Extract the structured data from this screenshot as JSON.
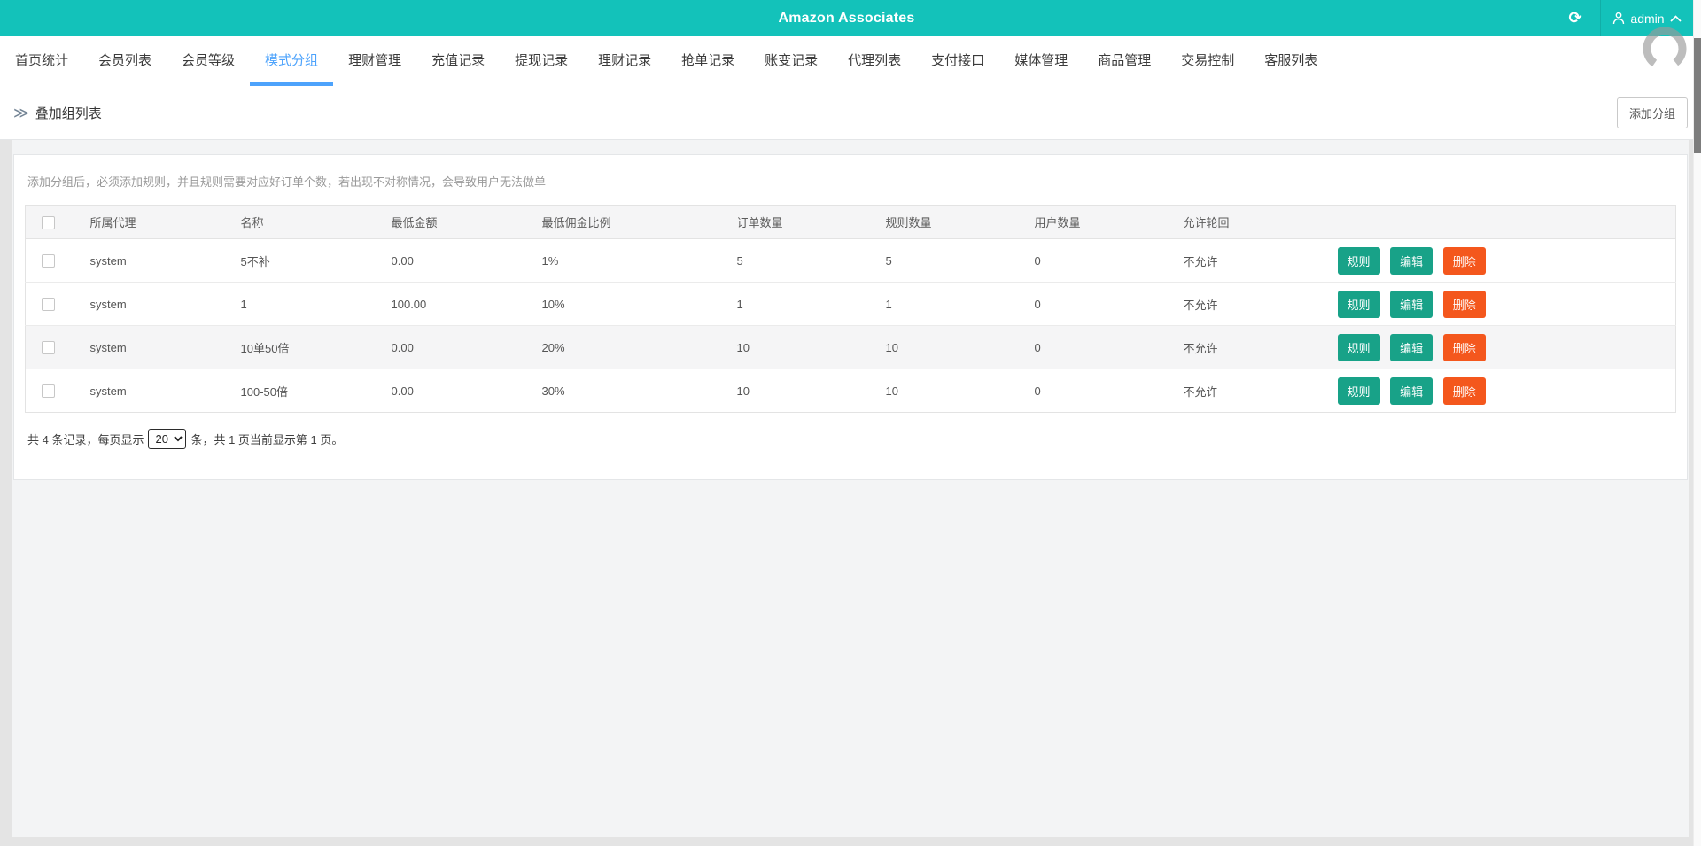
{
  "header": {
    "title": "Amazon Associates",
    "username": "admin",
    "icons": {
      "refresh_glyph": "⟳",
      "breadcrumb_glyph": "≫"
    }
  },
  "tabs": {
    "items": [
      {
        "label": "首页统计"
      },
      {
        "label": "会员列表"
      },
      {
        "label": "会员等级"
      },
      {
        "label": "模式分组"
      },
      {
        "label": "理财管理"
      },
      {
        "label": "充值记录"
      },
      {
        "label": "提现记录"
      },
      {
        "label": "理财记录"
      },
      {
        "label": "抢单记录"
      },
      {
        "label": "账变记录"
      },
      {
        "label": "代理列表"
      },
      {
        "label": "支付接口"
      },
      {
        "label": "媒体管理"
      },
      {
        "label": "商品管理"
      },
      {
        "label": "交易控制"
      },
      {
        "label": "客服列表"
      }
    ],
    "active_index": 3
  },
  "breadcrumb": {
    "title": "叠加组列表"
  },
  "toolbar": {
    "add_group_label": "添加分组"
  },
  "panel": {
    "hint": "添加分组后，必须添加规则，并且规则需要对应好订单个数，若出现不对称情况，会导致用户无法做单"
  },
  "table": {
    "columns": [
      "所属代理",
      "名称",
      "最低金额",
      "最低佣金比例",
      "订单数量",
      "规则数量",
      "用户数量",
      "允许轮回"
    ],
    "rows": [
      {
        "agent": "system",
        "name": "5不补",
        "min_amount": "0.00",
        "min_commission": "1%",
        "order_count": "5",
        "rule_count": "5",
        "user_count": "0",
        "allow_cycle": "不允许"
      },
      {
        "agent": "system",
        "name": "1",
        "min_amount": "100.00",
        "min_commission": "10%",
        "order_count": "1",
        "rule_count": "1",
        "user_count": "0",
        "allow_cycle": "不允许"
      },
      {
        "agent": "system",
        "name": "10单50倍",
        "min_amount": "0.00",
        "min_commission": "20%",
        "order_count": "10",
        "rule_count": "10",
        "user_count": "0",
        "allow_cycle": "不允许"
      },
      {
        "agent": "system",
        "name": "100-50倍",
        "min_amount": "0.00",
        "min_commission": "30%",
        "order_count": "10",
        "rule_count": "10",
        "user_count": "0",
        "allow_cycle": "不允许"
      }
    ],
    "actions": {
      "rule": "规则",
      "edit": "编辑",
      "delete": "删除"
    }
  },
  "pagination": {
    "prefix": "共 4 条记录，每页显示",
    "per_page": "20",
    "suffix": "条，共 1 页当前显示第 1 页。"
  },
  "colors": {
    "header_teal": "#13c2ba",
    "active_tab_blue": "#4da3fc",
    "action_green": "#18a288",
    "action_orange": "#f4571d"
  }
}
